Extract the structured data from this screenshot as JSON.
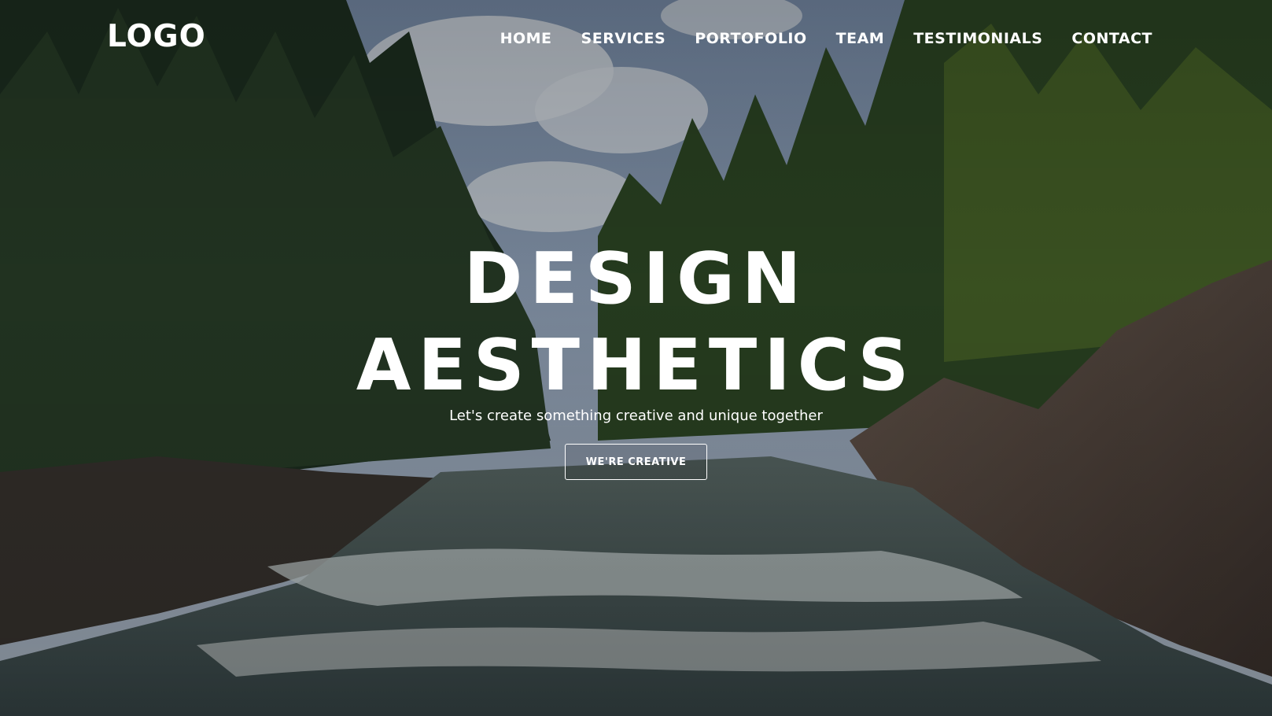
{
  "header": {
    "logo": "LOGO",
    "nav": [
      "HOME",
      "SERVICES",
      "PORTOFOLIO",
      "TEAM",
      "TESTIMONIALS",
      "CONTACT"
    ]
  },
  "hero": {
    "title_line1": "DESIGN",
    "title_line2": "AESTHETICS",
    "subtitle": "Let's create something creative and unique together",
    "cta_label": "WE'RE CREATIVE"
  },
  "background": {
    "description": "forest river landscape",
    "colors": {
      "sky": "#8fa3bd",
      "forest_dark": "#1f3222",
      "forest_light": "#4d6b2a",
      "rock": "#5e5048",
      "water": "#7d8e90",
      "foam": "#d9e0e0"
    }
  }
}
